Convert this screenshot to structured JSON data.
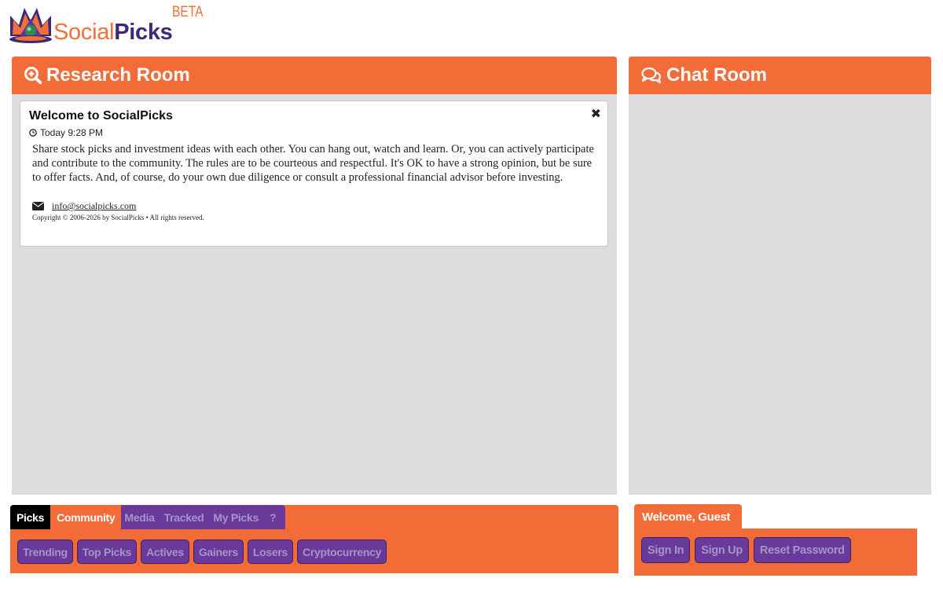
{
  "header": {
    "logo_social": "Social",
    "logo_picks": "Picks",
    "beta": "BETA"
  },
  "research_room": {
    "title": "Research Room",
    "icon": "search-plus-icon",
    "welcome_card": {
      "title": "Welcome to SocialPicks",
      "time": "Today 9:28 PM",
      "body": "Share stock picks and investment ideas with each other. You can hang out, watch and learn. Or, you can actively participate and contribute to the community. The rules are to be courteous and respectful. It's OK to have a strong opinion, but be sure to offer facts. And, of course, do your own due diligence or consult a professional financial advisor before investing.",
      "close": "✖",
      "email": "info@socialpicks.com",
      "copyright": "Copyright © 2006-2026 by SocialPicks • All rights reserved."
    }
  },
  "chat_room": {
    "title": "Chat Room",
    "icon": "comments-icon"
  },
  "bottom_nav": {
    "tabs": [
      "Picks",
      "Community",
      "Media",
      "Tracked",
      "My Picks",
      "?"
    ],
    "sub_buttons": [
      "Trending",
      "Top Picks",
      "Actives",
      "Gainers",
      "Losers",
      "Cryptocurrency"
    ]
  },
  "account": {
    "welcome": "Welcome, Guest",
    "sign_in": "Sign In",
    "sign_up": "Sign Up",
    "reset_password": "Reset Password"
  },
  "colors": {
    "brand_orange": "#f36b37",
    "brand_purple": "#6a3a9a",
    "panel_gray": "#dddddd"
  }
}
